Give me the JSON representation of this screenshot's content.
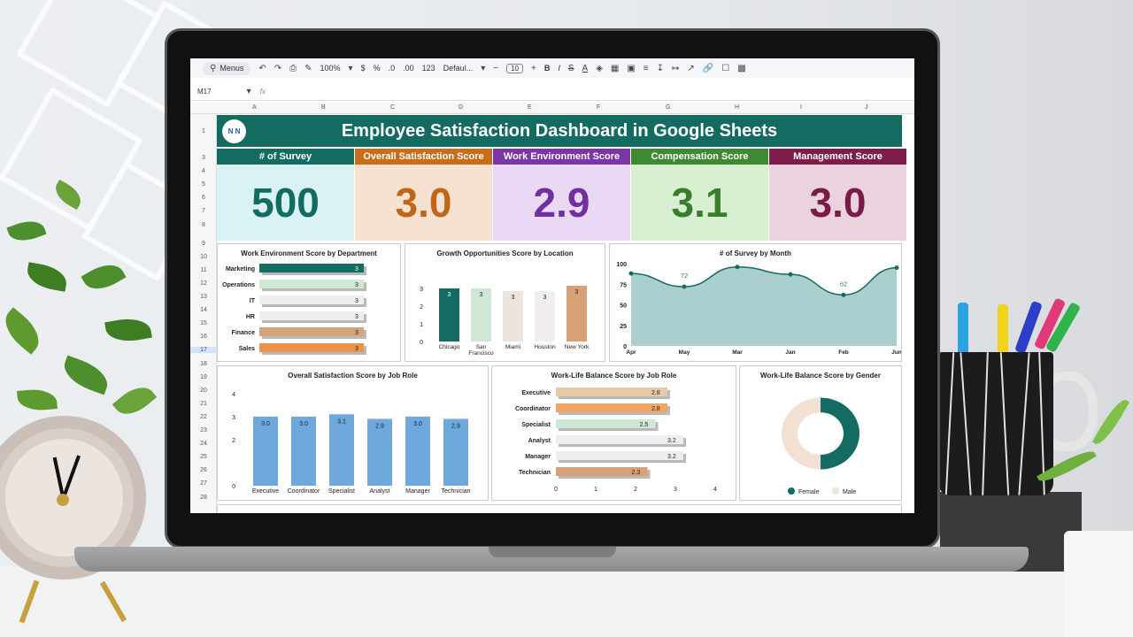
{
  "toolbar": {
    "menus": "Menus",
    "zoom": "100%",
    "currency": "$",
    "percent": "%",
    "dec_less": ".0",
    "dec_more": ".00",
    "number_format": "123",
    "font": "Defaul...",
    "font_size": "10",
    "bold": "B",
    "italic": "I"
  },
  "formula_bar": {
    "cell_ref": "M17",
    "fx": "fx"
  },
  "columns": [
    "A",
    "B",
    "C",
    "D",
    "E",
    "F",
    "G",
    "H",
    "I",
    "J"
  ],
  "rows": [
    "1",
    "3",
    "4",
    "5",
    "6",
    "7",
    "8",
    "9",
    "10",
    "11",
    "12",
    "13",
    "14",
    "15",
    "16",
    "17",
    "18",
    "19",
    "20",
    "21",
    "22",
    "23",
    "24",
    "25",
    "26",
    "27",
    "28"
  ],
  "dashboard": {
    "title": "Employee Satisfaction Dashboard in Google Sheets",
    "logo": "N N"
  },
  "kpis": [
    {
      "label": "# of Survey",
      "value": "500",
      "header_color": "#146b62",
      "body_color": "#d9f3f5",
      "value_color": "#146b62"
    },
    {
      "label": "Overall Satisfaction Score",
      "value": "3.0",
      "header_color": "#c86d1c",
      "body_color": "#f7e2d2",
      "value_color": "#c0661a"
    },
    {
      "label": "Work Environment Score",
      "value": "2.9",
      "header_color": "#7a36a6",
      "body_color": "#ead9f4",
      "value_color": "#7030a0"
    },
    {
      "label": "Compensation Score",
      "value": "3.1",
      "header_color": "#3d8a32",
      "body_color": "#d8efd2",
      "value_color": "#3a7d2c"
    },
    {
      "label": "Management Score",
      "value": "3.0",
      "header_color": "#7c1d4a",
      "body_color": "#ead3df",
      "value_color": "#7a1a46"
    }
  ],
  "charts": {
    "work_env_by_dept": {
      "title": "Work Environment Score by Department",
      "categories": [
        "Marketing",
        "Operations",
        "IT",
        "HR",
        "Finance",
        "Sales"
      ],
      "values": [
        3,
        3,
        3,
        3,
        3,
        3
      ],
      "labels": [
        "3",
        "3",
        "3",
        "3",
        "3",
        "3"
      ],
      "colors": [
        "#146b62",
        "#cfe8d5",
        "#eeeeee",
        "#eeeeee",
        "#d4a37a",
        "#e8944a"
      ]
    },
    "growth_by_location": {
      "title": "Growth Opportunities Score by Location",
      "categories": [
        "Chicago",
        "San Francisco",
        "Miami",
        "Houston",
        "New York"
      ],
      "values": [
        3,
        3,
        3,
        3,
        3
      ],
      "labels": [
        "3",
        "3",
        "3",
        "3",
        "3"
      ],
      "colors": [
        "#146b62",
        "#cfe8d5",
        "#eee4de",
        "#f3eeee",
        "#d8a075"
      ],
      "ytick_labels": [
        "0",
        "1",
        "2",
        "3",
        "3"
      ]
    },
    "survey_by_month": {
      "title": "# of Survey by Month",
      "categories": [
        "Apr",
        "May",
        "Mar",
        "Jan",
        "Feb",
        "Jun"
      ],
      "values": [
        88,
        72,
        96,
        87,
        62,
        95
      ],
      "point_labels": [
        "72",
        "62"
      ],
      "ytick_labels": [
        "0",
        "25",
        "50",
        "75",
        "100"
      ]
    },
    "overall_by_role": {
      "title": "Overall Satisfaction Score by Job Role",
      "categories": [
        "Executive",
        "Coordinator",
        "Specialist",
        "Analyst",
        "Manager",
        "Technician"
      ],
      "values": [
        3.0,
        3.0,
        3.1,
        2.9,
        3.0,
        2.9
      ],
      "labels": [
        "3.0",
        "3.0",
        "3.1",
        "2.9",
        "3.0",
        "2.9"
      ],
      "ytick_labels": [
        "0",
        "2",
        "3",
        "4"
      ]
    },
    "wlb_by_role": {
      "title": "Work-Life Balance Score by Job Role",
      "categories": [
        "Executive",
        "Coordinator",
        "Specialist",
        "Analyst",
        "Manager",
        "Technician"
      ],
      "values": [
        2.8,
        2.8,
        2.5,
        3.2,
        3.2,
        2.3
      ],
      "labels": [
        "2.8",
        "2.8",
        "2.5",
        "3.2",
        "3.2",
        "2.3"
      ],
      "colors": [
        "#e8c9a8",
        "#f0a663",
        "#cfe8d5",
        "#eeeeee",
        "#eeeeee",
        "#d8a075"
      ],
      "xtick_labels": [
        "0",
        "1",
        "2",
        "3",
        "4"
      ]
    },
    "wlb_by_gender": {
      "title": "Work-Life Balance Score by Gender",
      "legend": [
        "Female",
        "Male"
      ],
      "colors": [
        "#146b62",
        "#f2e1d2"
      ],
      "values": [
        50,
        50
      ]
    }
  },
  "chart_data": [
    {
      "type": "bar",
      "title": "Work Environment Score by Department",
      "categories": [
        "Marketing",
        "Operations",
        "IT",
        "HR",
        "Finance",
        "Sales"
      ],
      "values": [
        3,
        3,
        3,
        3,
        3,
        3
      ]
    },
    {
      "type": "bar",
      "title": "Growth Opportunities Score by Location",
      "categories": [
        "Chicago",
        "San Francisco",
        "Miami",
        "Houston",
        "New York"
      ],
      "values": [
        3,
        3,
        3,
        3,
        3
      ]
    },
    {
      "type": "area",
      "title": "# of Survey by Month",
      "categories": [
        "Apr",
        "May",
        "Mar",
        "Jan",
        "Feb",
        "Jun"
      ],
      "values": [
        88,
        72,
        96,
        87,
        62,
        95
      ],
      "ylim": [
        0,
        100
      ]
    },
    {
      "type": "bar",
      "title": "Overall Satisfaction Score by Job Role",
      "categories": [
        "Executive",
        "Coordinator",
        "Specialist",
        "Analyst",
        "Manager",
        "Technician"
      ],
      "values": [
        3.0,
        3.0,
        3.1,
        2.9,
        3.0,
        2.9
      ],
      "ylim": [
        0,
        4
      ]
    },
    {
      "type": "bar",
      "title": "Work-Life Balance Score by Job Role",
      "categories": [
        "Executive",
        "Coordinator",
        "Specialist",
        "Analyst",
        "Manager",
        "Technician"
      ],
      "values": [
        2.8,
        2.8,
        2.5,
        3.2,
        3.2,
        2.3
      ],
      "xlim": [
        0,
        4
      ]
    },
    {
      "type": "pie",
      "title": "Work-Life Balance Score by Gender",
      "categories": [
        "Female",
        "Male"
      ],
      "values": [
        50,
        50
      ]
    }
  ]
}
